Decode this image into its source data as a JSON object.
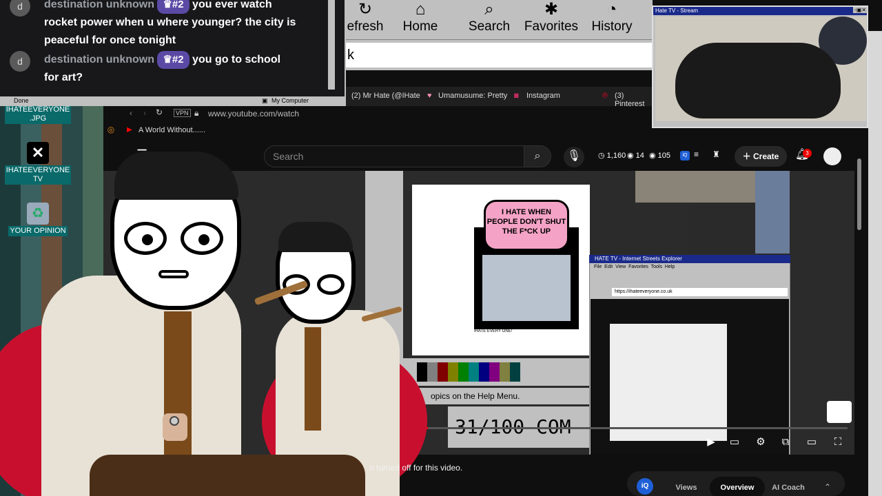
{
  "chat": {
    "messages": [
      {
        "avatar": "d",
        "user": "destination unknown",
        "badge": "#2",
        "line1": "you ever watch",
        "line2": "rocket power when u where younger? the city is",
        "line3": "peaceful for once tonight"
      },
      {
        "avatar": "d",
        "user": "destination unknown",
        "badge": "#2",
        "line1": "you go to school",
        "line2": "for art?"
      }
    ],
    "status_left": "Done",
    "status_right": "My Computer"
  },
  "ie_toolbar": {
    "buttons": [
      {
        "label": "efresh",
        "icon": "refresh-icon"
      },
      {
        "label": "Home",
        "icon": "home-icon"
      },
      {
        "label": "Search",
        "icon": "search-icon"
      },
      {
        "label": "Favorites",
        "icon": "favorites-icon"
      },
      {
        "label": "History",
        "icon": "history-icon"
      }
    ],
    "address_value": "k"
  },
  "desktop": {
    "icons": [
      {
        "label1": "IHATEEVERYONE",
        "label2": ".JPG"
      },
      {
        "label1": "IHATEEVERYONE",
        "label2": "TV"
      },
      {
        "label1": "YOUR OPINION",
        "label2": ""
      }
    ]
  },
  "browser": {
    "bookmarks": [
      "(2) Mr Hate (@IHate",
      "Umamusume: Pretty",
      "Instagram",
      "(3) Pinterest"
    ],
    "vpn": "VPN",
    "url": "www.youtube.com/watch",
    "tab_title": "A World Without......"
  },
  "youtube": {
    "search_placeholder": "Search",
    "stats": {
      "watching": "1,160",
      "viewers": "14",
      "likes": "105"
    },
    "create_label": "Create",
    "notifications": "3",
    "comments_off": "n turned off for this video.",
    "bottom_tabs": [
      "Views",
      "Overview",
      "AI Coach"
    ],
    "iq": "iQ",
    "progress": 0.13
  },
  "video": {
    "bubble_text": "I HATE WHEN PEOPLE DON'T SHUT THE F*CK UP",
    "signature": "IHATE EVERY ONE!",
    "paint_status": "opics on the Help Menu.",
    "counter": "31/100 COM",
    "mini_ie_title": "HATE TV - Internet Streets Explorer",
    "mini_ie_address": "https://ihateeveryone.co.uk",
    "mini_menu": [
      "File",
      "Edit",
      "View",
      "Favorites",
      "Tools",
      "Help"
    ]
  },
  "cam": {
    "title": "Hate TV - Stream"
  },
  "colors": {
    "chat_bg": "#18181b",
    "badge": "#5b4aa5",
    "win_gray": "#c0c0c0",
    "yt_bg": "#0f0f0f",
    "progress_red": "#ff0000",
    "bubble_pink": "#f4a3c6",
    "chair_red": "#c8102e"
  }
}
